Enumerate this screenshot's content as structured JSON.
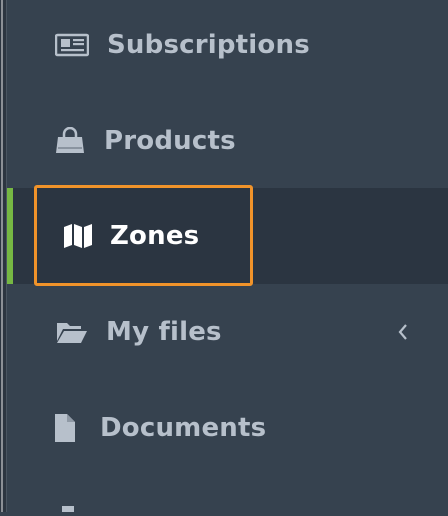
{
  "sidebar": {
    "items": [
      {
        "label": "Subscriptions",
        "icon": "newspaper-icon"
      },
      {
        "label": "Products",
        "icon": "shopping-bag-icon"
      },
      {
        "label": "Zones",
        "icon": "map-icon"
      },
      {
        "label": "My files",
        "icon": "folder-open-icon"
      },
      {
        "label": "Documents",
        "icon": "file-icon"
      }
    ]
  },
  "colors": {
    "background": "#36424f",
    "active_background": "#2b3541",
    "active_indicator": "#76b843",
    "focus_outline": "#f0932a",
    "text": "#b7c0cb",
    "active_text": "#ffffff"
  }
}
